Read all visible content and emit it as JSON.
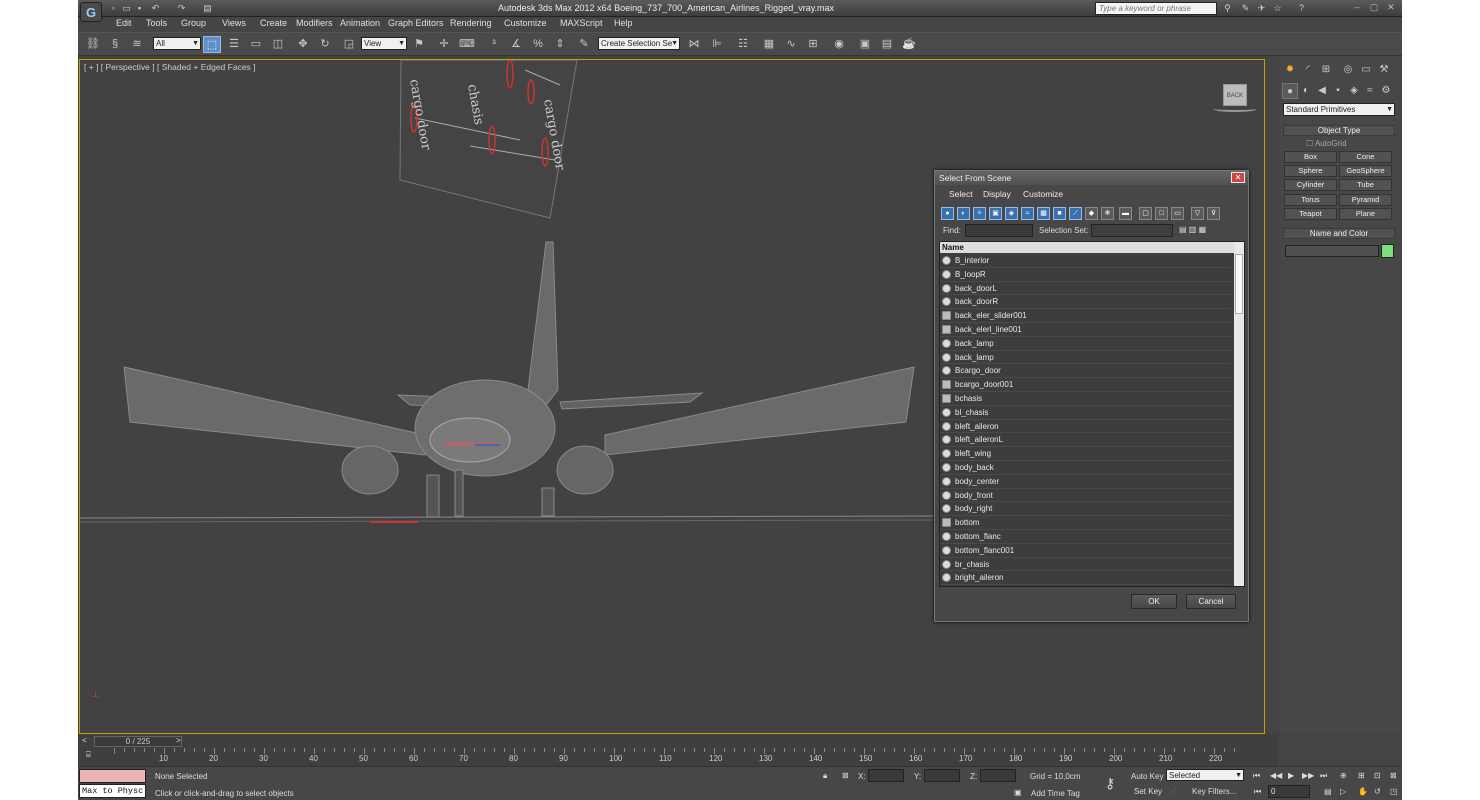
{
  "app": {
    "title": "Autodesk 3ds Max  2012 x64     Boeing_737_700_American_Airlines_Rigged_vray.max",
    "search_placeholder": "Type a keyword or phrase"
  },
  "menu": [
    "Edit",
    "Tools",
    "Group",
    "Views",
    "Create",
    "Modifiers",
    "Animation",
    "Graph Editors",
    "Rendering",
    "Customize",
    "MAXScript",
    "Help"
  ],
  "toolbar": {
    "filter": "All",
    "refcoord": "View",
    "named_selection": "Create Selection Se"
  },
  "viewport": {
    "label": "[ + ] [ Perspective ] [ Shaded + Edged Faces ]",
    "viewcube_label": "BACK",
    "reference_labels": [
      "cargo door",
      "chasis",
      "cargo door"
    ]
  },
  "dialog": {
    "title": "Select From Scene",
    "menu": [
      "Select",
      "Display",
      "Customize"
    ],
    "find_label": "Find:",
    "selection_set_label": "Selection Set:",
    "column": "Name",
    "items": [
      {
        "name": "B_interior",
        "type": "geo"
      },
      {
        "name": "B_loopR",
        "type": "geo"
      },
      {
        "name": "back_doorL",
        "type": "geo"
      },
      {
        "name": "back_doorR",
        "type": "geo"
      },
      {
        "name": "back_eler_slider001",
        "type": "helper"
      },
      {
        "name": "back_elerl_line001",
        "type": "helper"
      },
      {
        "name": "back_lamp",
        "type": "geo"
      },
      {
        "name": "back_lamp",
        "type": "geo"
      },
      {
        "name": "Bcargo_door",
        "type": "geo"
      },
      {
        "name": "bcargo_door001",
        "type": "helper"
      },
      {
        "name": "bchasis",
        "type": "helper"
      },
      {
        "name": "bl_chasis",
        "type": "geo"
      },
      {
        "name": "bleft_aileron",
        "type": "geo"
      },
      {
        "name": "bleft_aileronL",
        "type": "geo"
      },
      {
        "name": "bleft_wing",
        "type": "geo"
      },
      {
        "name": "body_back",
        "type": "geo"
      },
      {
        "name": "body_center",
        "type": "geo"
      },
      {
        "name": "body_front",
        "type": "geo"
      },
      {
        "name": "body_right",
        "type": "geo"
      },
      {
        "name": "bottom",
        "type": "helper"
      },
      {
        "name": "bottom_flanc",
        "type": "geo"
      },
      {
        "name": "bottom_flanc001",
        "type": "geo"
      },
      {
        "name": "br_chasis",
        "type": "geo"
      },
      {
        "name": "bright_aileron",
        "type": "geo"
      }
    ],
    "ok": "OK",
    "cancel": "Cancel"
  },
  "command_panel": {
    "dropdown": "Standard Primitives",
    "object_type": "Object Type",
    "autogrid": "AutoGrid",
    "primitives": [
      "Box",
      "Cone",
      "Sphere",
      "GeoSphere",
      "Cylinder",
      "Tube",
      "Torus",
      "Pyramid",
      "Teapot",
      "Plane"
    ],
    "name_and_color": "Name and Color",
    "color": "#7de07d"
  },
  "timeline": {
    "frame": "0 / 225",
    "ticks": [
      "10",
      "20",
      "30",
      "40",
      "50",
      "60",
      "70",
      "80",
      "90",
      "100",
      "110",
      "120",
      "130",
      "140",
      "150",
      "160",
      "170",
      "180",
      "190",
      "200",
      "210",
      "220"
    ]
  },
  "status": {
    "maxscript": "Max to Physc",
    "selection": "None Selected",
    "prompt": "Click or click-and-drag to select objects",
    "x": "X:",
    "y": "Y:",
    "z": "Z:",
    "grid": "Grid = 10,0cm",
    "add_time_tag": "Add Time Tag",
    "auto_key": "Auto Key",
    "set_key": "Set Key",
    "key_mode": "Selected",
    "key_filters": "Key Filters...",
    "frame_field": "0"
  }
}
